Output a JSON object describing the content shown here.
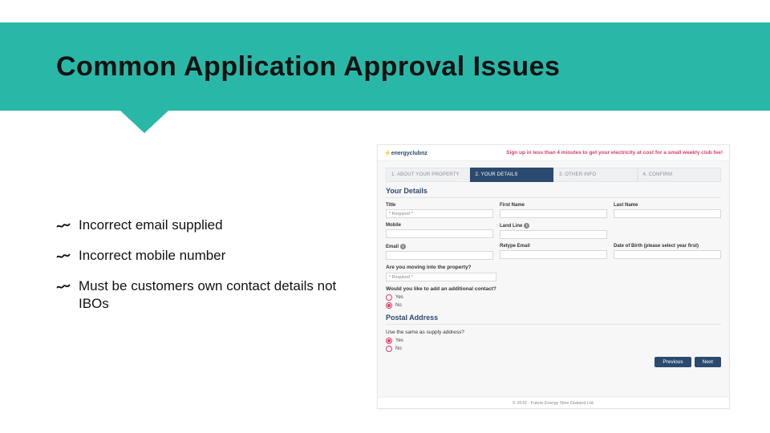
{
  "slide": {
    "title": "Common Application Approval Issues",
    "bullets": [
      "Incorrect email supplied",
      "Incorrect mobile number",
      "Must be customers own contact details not IBOs"
    ]
  },
  "screenshot": {
    "brand": "energyclubnz",
    "tagline": "Sign up in less than 4 minutes to get your electricity at cost for a small weekly club fee!",
    "steps": [
      {
        "label": "1. ABOUT YOUR PROPERTY",
        "active": false
      },
      {
        "label": "2. YOUR DETAILS",
        "active": true
      },
      {
        "label": "3. OTHER INFO",
        "active": false
      },
      {
        "label": "4. CONFIRM",
        "active": false
      }
    ],
    "section_title": "Your Details",
    "fields": {
      "title_label": "Title",
      "title_placeholder": "* Required *",
      "first_name_label": "First Name",
      "last_name_label": "Last Name",
      "mobile_label": "Mobile",
      "landline_label": "Land Line",
      "email_label": "Email",
      "retype_email_label": "Retype Email",
      "dob_label": "Date of Birth (please select year first)"
    },
    "moving_q": "Are you moving into the property?",
    "moving_placeholder": "* Required *",
    "add_contact_q": "Would you like to add an additional contact?",
    "radio_yes": "Yes",
    "radio_no": "No",
    "postal_section": "Postal Address",
    "postal_q": "Use the same as supply address?",
    "btn_prev": "Previous",
    "btn_next": "Next",
    "footer": "© 2019 - Future Energy New Zealand Ltd."
  }
}
